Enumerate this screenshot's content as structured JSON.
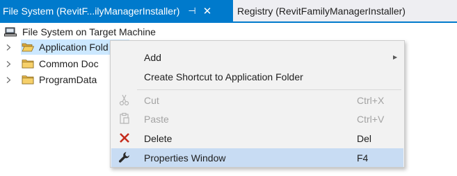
{
  "tabs": {
    "active": {
      "label": "File System (RevitF...ilyManagerInstaller)",
      "pin": "⊣",
      "close": "✕"
    },
    "inactive": {
      "label": "Registry (RevitFamilyManagerInstaller)"
    }
  },
  "tree": {
    "root": {
      "label": "File System on Target Machine",
      "icon": "computer-icon"
    },
    "items": [
      {
        "label": "Application Fold",
        "icon": "folder-open-icon"
      },
      {
        "label": "Common Doc",
        "icon": "folder-icon"
      },
      {
        "label": "ProgramData",
        "icon": "folder-icon"
      }
    ]
  },
  "context_menu": {
    "add": {
      "label": "Add",
      "submenu_arrow": "▶"
    },
    "create_shortcut": {
      "label": "Create Shortcut to Application Folder"
    },
    "cut": {
      "label": "Cut",
      "shortcut": "Ctrl+X",
      "icon": "scissors-icon"
    },
    "paste": {
      "label": "Paste",
      "shortcut": "Ctrl+V",
      "icon": "clipboard-icon"
    },
    "delete": {
      "label": "Delete",
      "shortcut": "Del",
      "icon": "delete-x-icon"
    },
    "properties": {
      "label": "Properties Window",
      "shortcut": "F4",
      "icon": "wrench-icon"
    }
  },
  "colors": {
    "accent": "#007acc",
    "selection": "#cce8ff",
    "menu_highlight": "#c8dcf3",
    "delete_red": "#c42b1c"
  }
}
